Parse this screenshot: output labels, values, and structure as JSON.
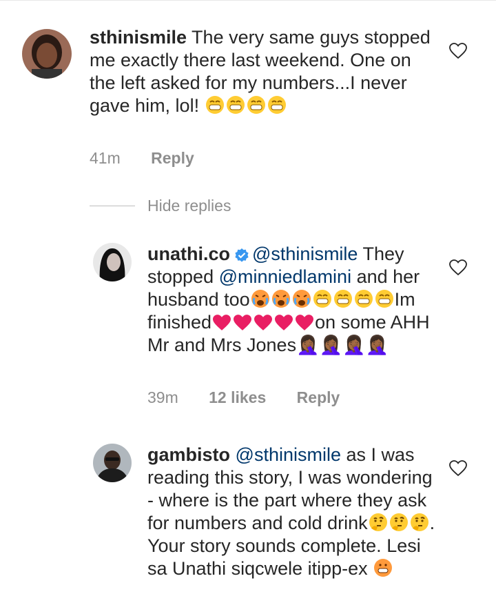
{
  "comments": [
    {
      "username": "sthinismile",
      "text_part1": " The very same guys stopped me exactly there last weekend. One on the left asked for my numbers...I never gave him, lol! ",
      "emoji_count": 4,
      "time": "41m",
      "reply_label": "Reply"
    },
    {
      "username": "unathi.co",
      "mention": "@sthinismile",
      "text_part1": " They stopped ",
      "mention2": "@minniedlamini",
      "text_part2": " and her husband too",
      "text_part3": "Im finished",
      "text_part4": "on some AHH Mr and Mrs Jones",
      "missing_glyphs": "🤦🏾‍♀️🤦🏾‍♀️🤦🏾‍♀️🤦🏾‍♀️",
      "time": "39m",
      "likes": "12 likes",
      "reply_label": "Reply"
    },
    {
      "username": "gambisto",
      "mention": "@sthinismile",
      "text_part1": " as I was reading this story, I was wondering - where is the part where they ask for numbers and cold drink",
      "text_part2": ". Your story sounds complete. Lesi sa Unathi siqcwele itipp-ex"
    }
  ],
  "hide_replies_label": "Hide replies",
  "colors": {
    "text": "#262626",
    "mention": "#00376b",
    "meta": "#8e8e8e",
    "verified": "#3897f0",
    "heart": "#e91e63"
  }
}
